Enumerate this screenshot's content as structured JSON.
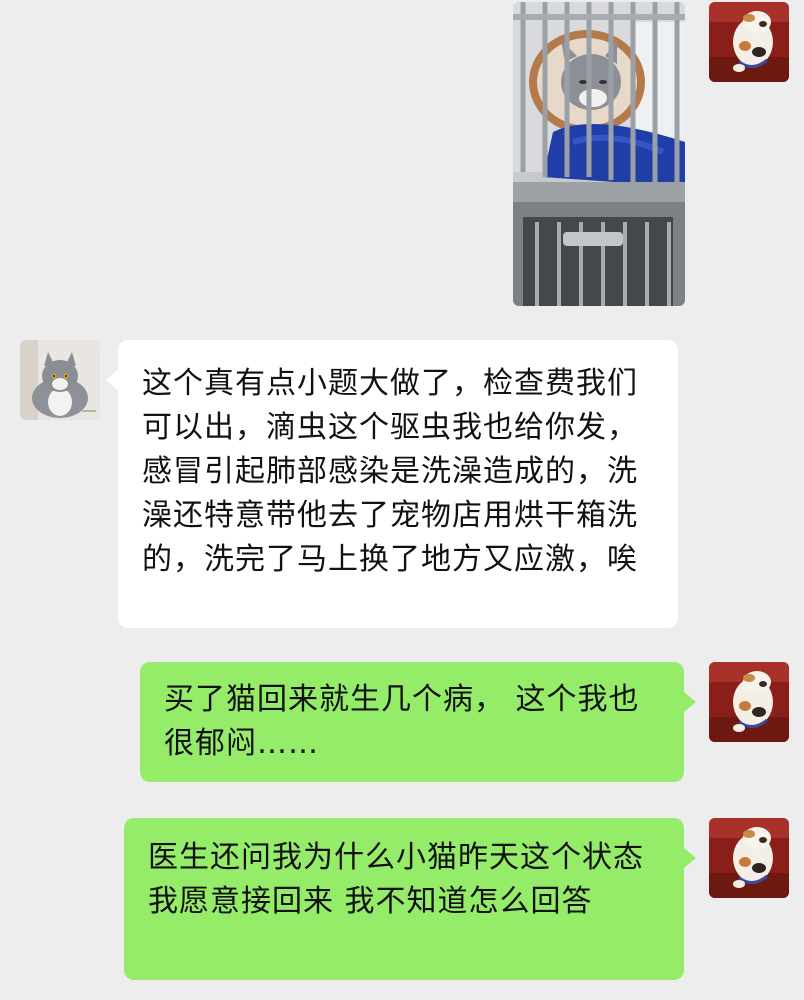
{
  "chat": {
    "messages": [
      {
        "sender": "self",
        "type": "image",
        "image": "cat-in-clinic-cage-photo"
      },
      {
        "sender": "other",
        "type": "text",
        "text": "这个真有点小题大做了，检查费我们可以出，滴虫这个驱虫我也给你发，感冒引起肺部感染是洗澡造成的，洗澡还特意带他去了宠物店用烘干箱洗的，洗完了马上换了地方又应激，唉"
      },
      {
        "sender": "self",
        "type": "text",
        "text": " 买了猫回来就生几个病， 这个我也很郁闷……"
      },
      {
        "sender": "self",
        "type": "text",
        "text": "医生还问我为什么小猫昨天这个状态我愿意接回来 我不知道怎么回答"
      }
    ]
  },
  "avatars": {
    "self": "calico-cat-avatar-icon",
    "other": "grey-white-cat-avatar-icon"
  },
  "colors": {
    "background": "#ededed",
    "incoming_bubble": "#ffffff",
    "outgoing_bubble": "#95ec69",
    "text": "#111111"
  }
}
